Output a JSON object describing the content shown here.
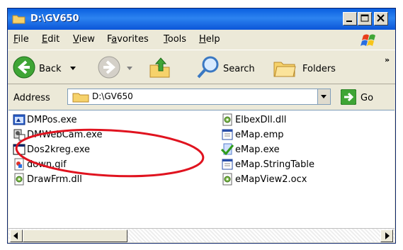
{
  "window": {
    "title": "D:\\GV650"
  },
  "menu": {
    "items": [
      "File",
      "Edit",
      "View",
      "Favorites",
      "Tools",
      "Help"
    ],
    "underlines": [
      "F",
      "E",
      "V",
      "a",
      "T",
      "H"
    ]
  },
  "toolbar": {
    "back_label": "Back",
    "search_label": "Search",
    "folders_label": "Folders",
    "chevron": "»"
  },
  "address": {
    "label": "Address",
    "path": "D:\\GV650",
    "go_label": "Go"
  },
  "files": [
    {
      "name": "DMPos.exe",
      "icon": "exe-window-icon"
    },
    {
      "name": "DMWebCam.exe",
      "icon": "webcam-exe-icon"
    },
    {
      "name": "Dos2kreg.exe",
      "icon": "console-window-icon"
    },
    {
      "name": "down.gif",
      "icon": "image-file-icon"
    },
    {
      "name": "DrawFrm.dll",
      "icon": "dll-gear-icon"
    },
    {
      "name": "ElbexDll.dll",
      "icon": "dll-gear-icon"
    },
    {
      "name": "eMap.emp",
      "icon": "generic-file-icon"
    },
    {
      "name": "eMap.exe",
      "icon": "checkmark-exe-icon"
    },
    {
      "name": "eMap.StringTable",
      "icon": "generic-file-icon"
    },
    {
      "name": "eMapView2.ocx",
      "icon": "dll-gear-icon"
    }
  ],
  "colors": {
    "titlebar": "#0a5fe0",
    "chrome": "#ece9d8",
    "annotation_circle": "#e0131f",
    "selection": "#316ac5"
  }
}
